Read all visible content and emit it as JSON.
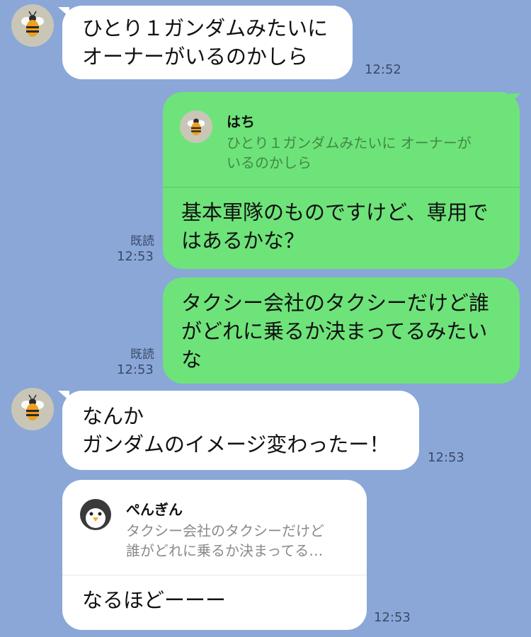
{
  "messages": [
    {
      "text": "ひとり１ガンダムみたいに\nオーナーがいるのかしら",
      "time": "12:52"
    },
    {
      "quote": {
        "name": "はち",
        "text": "ひとり１ガンダムみたいに オーナーが\nいるのかしら"
      },
      "text": "基本軍隊のものですけど、専用で\nはあるかな？",
      "read": "既読",
      "time": "12:53"
    },
    {
      "text": "タクシー会社のタクシーだけど誰\nがどれに乗るか決まってるみたい\nな",
      "read": "既読",
      "time": "12:53"
    },
    {
      "text": "なんか\nガンダムのイメージ変わったー！",
      "time": "12:53"
    },
    {
      "quote": {
        "name": "ぺんぎん",
        "text": "タクシー会社のタクシーだけど\n誰がどれに乗るか決まってる…"
      },
      "text": "なるほどーーー",
      "time": "12:53"
    }
  ],
  "icons": {
    "bee_avatar": "bee-avatar-icon",
    "penguin_avatar": "penguin-avatar-icon"
  },
  "colors": {
    "background": "#8aa7d8",
    "incoming_bubble": "#ffffff",
    "outgoing_bubble": "#6ee37a"
  }
}
